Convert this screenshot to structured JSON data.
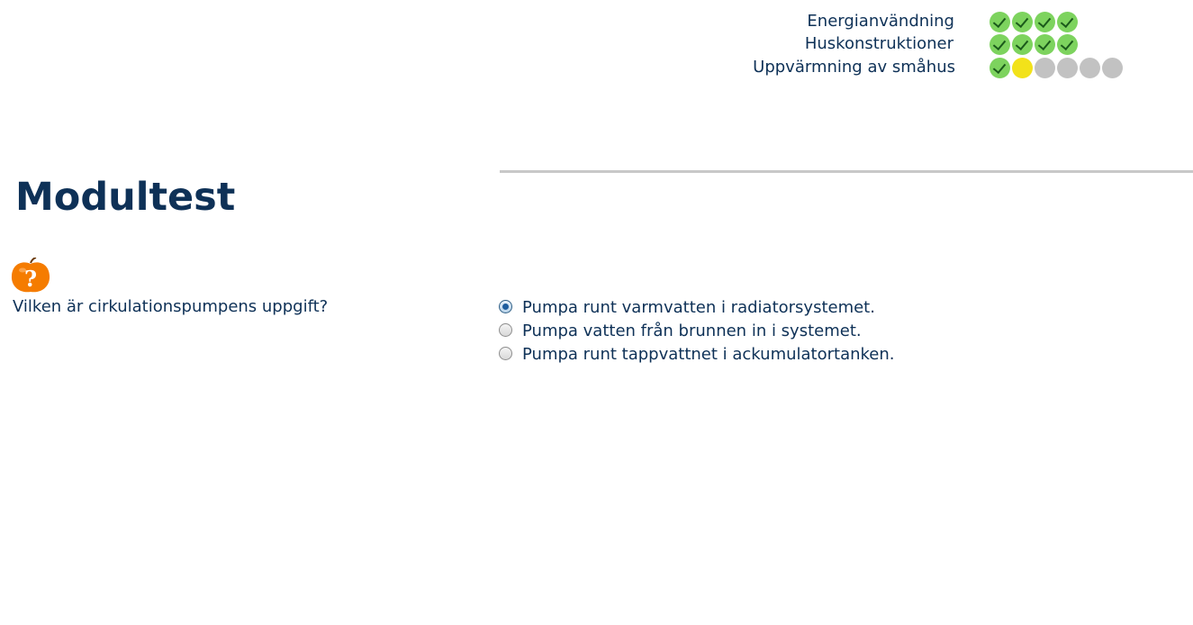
{
  "progress": {
    "modules": [
      {
        "label": "Energianvändning",
        "steps": [
          "done",
          "done",
          "done",
          "done"
        ]
      },
      {
        "label": "Huskonstruktioner",
        "steps": [
          "done",
          "done",
          "done",
          "done"
        ]
      },
      {
        "label": "Uppvärmning av småhus",
        "steps": [
          "done",
          "current",
          "todo",
          "todo",
          "todo",
          "todo"
        ]
      }
    ],
    "colors": {
      "done": "#7dd35e",
      "current": "#f2e21a",
      "todo": "#c2c2c2"
    }
  },
  "page": {
    "title": "Modultest"
  },
  "quiz": {
    "icon": "question-apple-icon",
    "question": "Vilken är cirkulationspumpens uppgift?",
    "answers": [
      {
        "label": "Pumpa runt varmvatten i radiatorsystemet.",
        "selected": true
      },
      {
        "label": "Pumpa vatten från brunnen in i systemet.",
        "selected": false
      },
      {
        "label": "Pumpa runt tappvattnet i ackumulatortanken.",
        "selected": false
      }
    ]
  },
  "theme": {
    "text": "#0e3157",
    "accent": "#f57c00"
  }
}
